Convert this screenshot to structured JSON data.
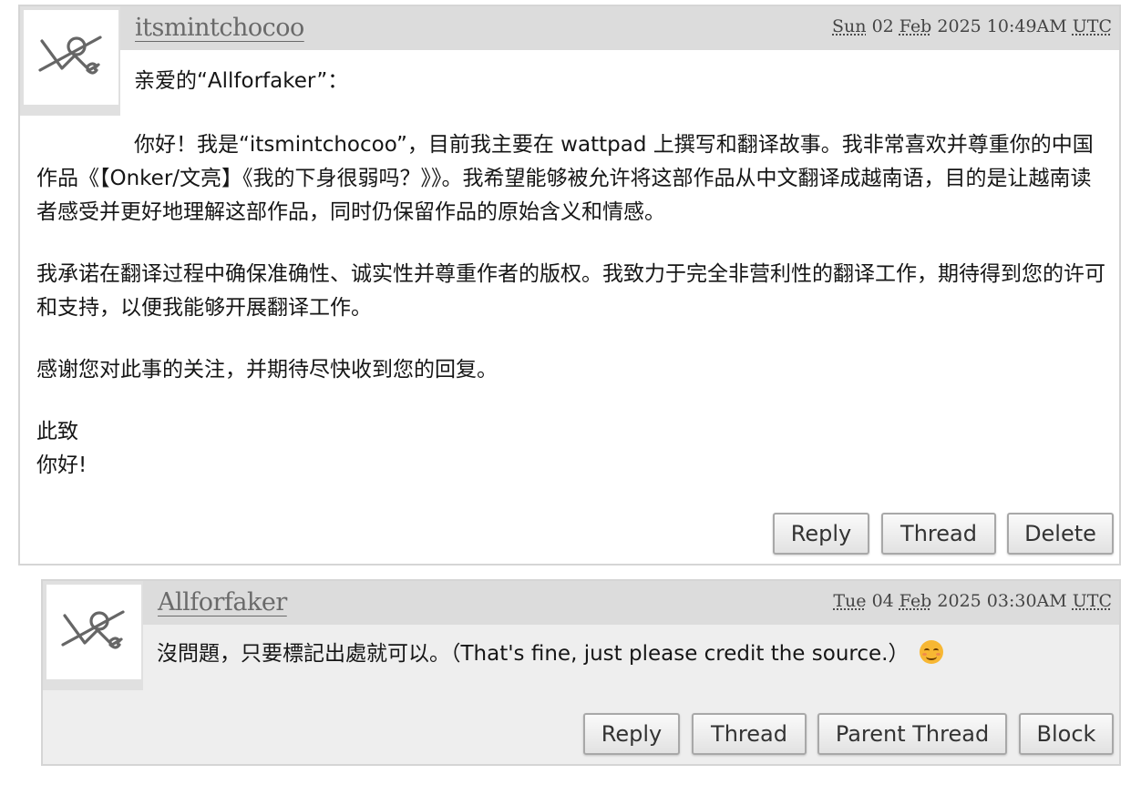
{
  "comments": [
    {
      "username": "itsmintchocoo",
      "date": {
        "day": "Sun",
        "rest": " 02 ",
        "month": "Feb",
        "time": " 2025 10:49AM ",
        "tz": "UTC"
      },
      "greeting": "亲爱的“Allforfaker”：",
      "paragraphs": [
        "你好！我是“itsmintchocoo”，目前我主要在 wattpad 上撰写和翻译故事。我非常喜欢并尊重你的中国作品《【Onker/文亮】《我的下身很弱吗？》》。我希望能够被允许将这部作品从中文翻译成越南语，目的是让越南读者感受并更好地理解这部作品，同时仍保留作品的原始含义和情感。",
        "我承诺在翻译过程中确保准确性、诚实性并尊重作者的版权。我致力于完全非营利性的翻译工作，期待得到您的许可和支持，以便我能够开展翻译工作。",
        "感谢您对此事的关注，并期待尽快收到您的回复。",
        "此致",
        "你好!"
      ],
      "buttons": {
        "reply": "Reply",
        "thread": "Thread",
        "delete": "Delete"
      }
    },
    {
      "username": "Allforfaker",
      "date": {
        "day": "Tue",
        "rest": " 04 ",
        "month": "Feb",
        "time": " 2025 03:30AM ",
        "tz": "UTC"
      },
      "message": "沒問題，只要標記出處就可以。（That's fine, just please credit the source.）",
      "emoji": "smiling-face-icon",
      "buttons": {
        "reply": "Reply",
        "thread": "Thread",
        "parent_thread": "Parent Thread",
        "block": "Block"
      }
    }
  ],
  "colors": {
    "header_bg": "#dcdcdc",
    "reply_bg": "#eeeeee",
    "border": "#d5d5d5",
    "username": "#6a6a6a"
  }
}
